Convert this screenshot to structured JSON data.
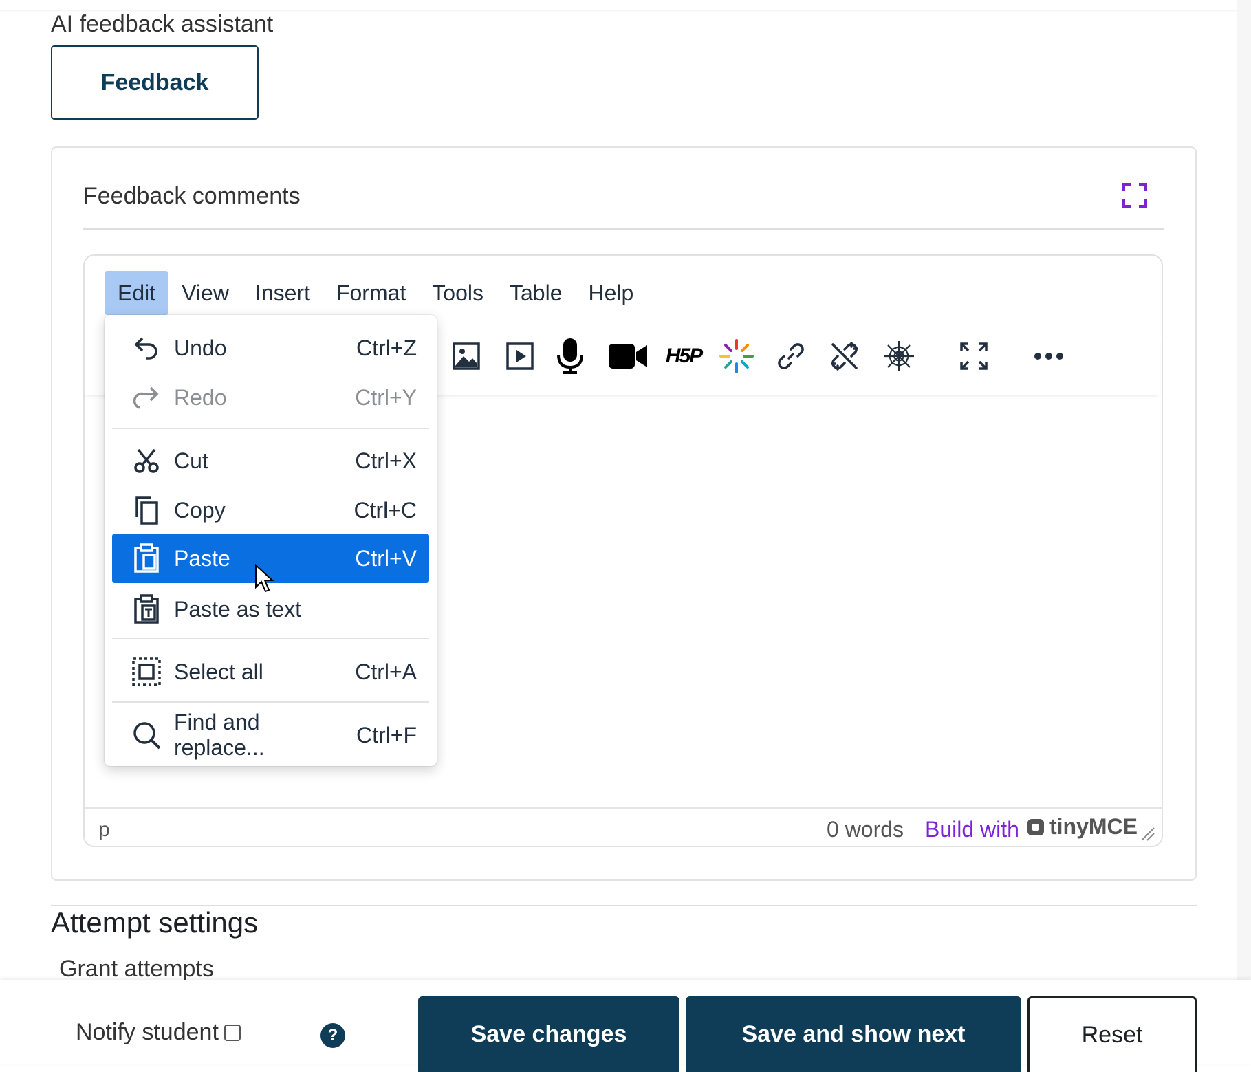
{
  "ai_assistant": {
    "label": "AI feedback assistant",
    "button": "Feedback"
  },
  "card": {
    "title": "Feedback comments"
  },
  "editor": {
    "menubar": [
      "Edit",
      "View",
      "Insert",
      "Format",
      "Tools",
      "Table",
      "Help"
    ],
    "active_menu": "Edit",
    "toolbar_icons": [
      "image-icon",
      "media-icon",
      "microphone-icon",
      "video-camera-icon",
      "h5p-icon",
      "ai-sparkle-icon",
      "link-icon",
      "unlink-icon",
      "web-icon",
      "fullscreen-icon",
      "more-icon"
    ],
    "status": {
      "element": "p",
      "words": "0 words",
      "build": "Build with",
      "brand": "tinyMCE"
    }
  },
  "edit_menu": {
    "items": [
      {
        "label": "Undo",
        "shortcut": "Ctrl+Z",
        "icon": "undo-icon"
      },
      {
        "label": "Redo",
        "shortcut": "Ctrl+Y",
        "icon": "redo-icon",
        "disabled": true
      },
      {
        "label": "Cut",
        "shortcut": "Ctrl+X",
        "icon": "cut-icon"
      },
      {
        "label": "Copy",
        "shortcut": "Ctrl+C",
        "icon": "copy-icon"
      },
      {
        "label": "Paste",
        "shortcut": "Ctrl+V",
        "icon": "paste-icon",
        "highlighted": true
      },
      {
        "label": "Paste as text",
        "shortcut": "",
        "icon": "paste-text-icon"
      },
      {
        "label": "Select all",
        "shortcut": "Ctrl+A",
        "icon": "select-all-icon"
      },
      {
        "label": "Find and replace...",
        "shortcut": "Ctrl+F",
        "icon": "search-icon"
      }
    ]
  },
  "attempt": {
    "title": "Attempt settings",
    "grant": "Grant attempts"
  },
  "footer": {
    "notify": "Notify student",
    "help": "?",
    "save": "Save changes",
    "save_next": "Save and show next",
    "reset": "Reset"
  },
  "colors": {
    "primary": "#0f3d57",
    "highlight": "#0a6fe0",
    "menu_active": "#a9c9f5",
    "brand_purple": "#7b23d9"
  }
}
